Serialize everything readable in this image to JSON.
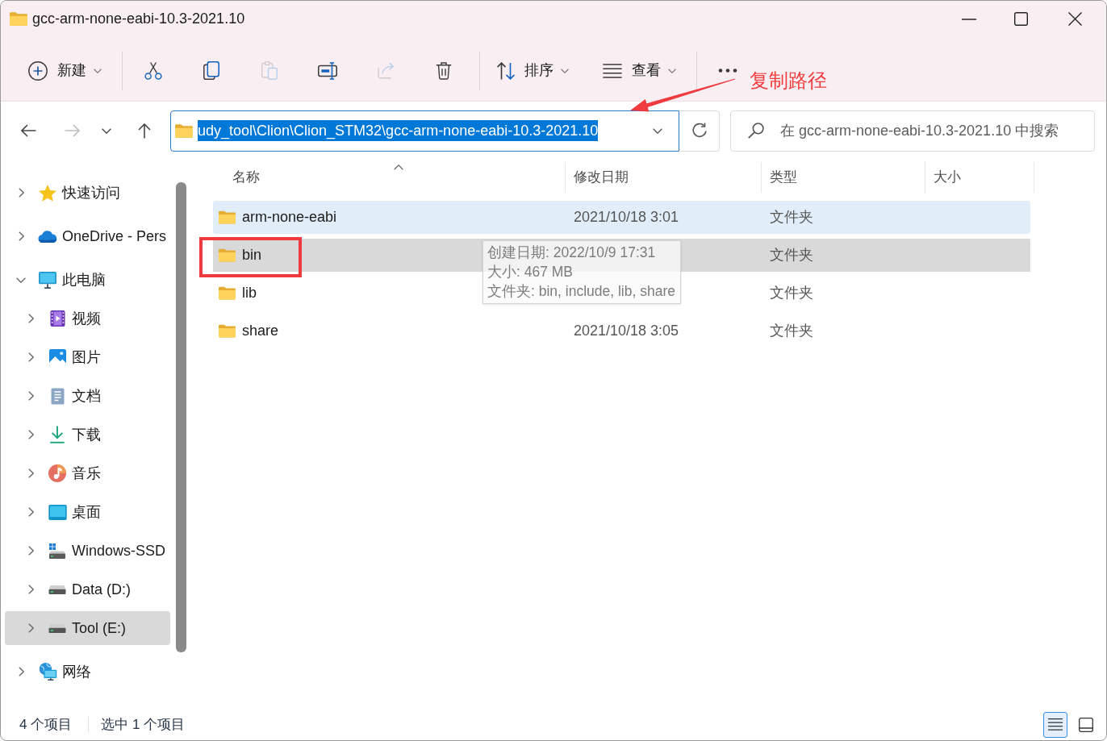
{
  "window": {
    "title": "gcc-arm-none-eabi-10.3-2021.10"
  },
  "toolbar": {
    "groups": [
      {
        "items": [
          {
            "kind": "new",
            "label": "新建",
            "dropdown": true,
            "disabled": false
          }
        ]
      },
      {
        "items": [
          {
            "kind": "cut",
            "dropdown": false,
            "disabled": false
          },
          {
            "kind": "copy",
            "dropdown": false,
            "disabled": false
          },
          {
            "kind": "paste",
            "dropdown": false,
            "disabled": true
          },
          {
            "kind": "rename",
            "dropdown": false,
            "disabled": false
          },
          {
            "kind": "share",
            "dropdown": false,
            "disabled": true
          },
          {
            "kind": "delete",
            "dropdown": false,
            "disabled": false
          }
        ]
      },
      {
        "items": [
          {
            "kind": "sort",
            "label": "排序",
            "dropdown": true,
            "disabled": false
          },
          {
            "kind": "view",
            "label": "查看",
            "dropdown": true,
            "disabled": false
          }
        ]
      },
      {
        "items": [
          {
            "kind": "more",
            "dropdown": false,
            "disabled": false
          }
        ]
      }
    ]
  },
  "annotation": {
    "text": "复制路径"
  },
  "navigation": {
    "buttons": [
      {
        "kind": "back",
        "disabled": false
      },
      {
        "kind": "forward",
        "disabled": true
      },
      {
        "kind": "recent",
        "disabled": false
      },
      {
        "kind": "up",
        "disabled": false
      }
    ]
  },
  "address_bar": {
    "path": "udy_tool\\Clion\\Clion_STM32\\gcc-arm-none-eabi-10.3-2021.10",
    "text_selected": true
  },
  "search": {
    "placeholder": "在 gcc-arm-none-eabi-10.3-2021.10 中搜索"
  },
  "sidebar": {
    "items": [
      {
        "kind": "star",
        "label": "快速访问",
        "expanded": false,
        "selected": false
      },
      {
        "kind": "cloud",
        "label": "OneDrive - Pers",
        "expanded": false,
        "selected": false
      },
      {
        "kind": "pc",
        "label": "此电脑",
        "expanded": true,
        "selected": false,
        "children": [
          {
            "kind": "video",
            "label": "视频",
            "expanded": false,
            "selected": false
          },
          {
            "kind": "pictures",
            "label": "图片",
            "expanded": false,
            "selected": false
          },
          {
            "kind": "documents",
            "label": "文档",
            "expanded": false,
            "selected": false
          },
          {
            "kind": "downloads",
            "label": "下载",
            "expanded": false,
            "selected": false
          },
          {
            "kind": "music",
            "label": "音乐",
            "expanded": false,
            "selected": false
          },
          {
            "kind": "desktop",
            "label": "桌面",
            "expanded": false,
            "selected": false
          },
          {
            "kind": "system-drive",
            "label": "Windows-SSD",
            "expanded": false,
            "selected": false
          },
          {
            "kind": "drive",
            "label": "Data (D:)",
            "expanded": false,
            "selected": false
          },
          {
            "kind": "drive",
            "label": "Tool (E:)",
            "expanded": false,
            "selected": true
          }
        ]
      },
      {
        "kind": "network",
        "label": "网络",
        "expanded": false,
        "selected": false
      }
    ]
  },
  "table": {
    "columns": [
      {
        "label": "名称",
        "sorted": true
      },
      {
        "label": "修改日期",
        "sorted": false
      },
      {
        "label": "类型",
        "sorted": false
      },
      {
        "label": "大小",
        "sorted": false
      }
    ],
    "rows": [
      {
        "name": "arm-none-eabi",
        "date": "2021/10/18 3:01",
        "type": "文件夹",
        "hovered": true,
        "selected": false,
        "marked": false
      },
      {
        "name": "bin",
        "type": "文件夹",
        "hovered": false,
        "selected": true,
        "marked": true,
        "tooltip": {
          "lines": [
            "创建日期: 2022/10/9 17:31",
            "大小: 467 MB",
            "文件夹: bin, include, lib, share"
          ]
        }
      },
      {
        "name": "lib",
        "type": "文件夹",
        "hovered": false,
        "selected": false,
        "marked": false
      },
      {
        "name": "share",
        "date": "2021/10/18 3:05",
        "type": "文件夹",
        "hovered": false,
        "selected": false,
        "marked": false
      }
    ]
  },
  "status_bar": {
    "item_count": "4 个项目",
    "selection": "选中 1 个项目",
    "views": [
      {
        "kind": "details",
        "selected": true
      },
      {
        "kind": "tiles",
        "selected": false
      }
    ]
  }
}
